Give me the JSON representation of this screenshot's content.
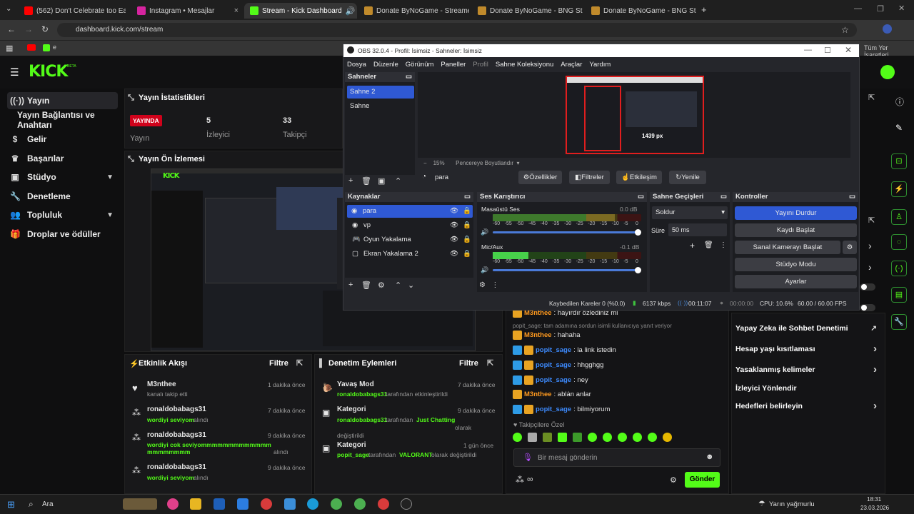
{
  "browser": {
    "tabs": [
      {
        "label": "(562) Don't Celebrate too Early",
        "color": "#ff0000"
      },
      {
        "label": "Instagram • Mesajlar",
        "color": "#d6249f"
      },
      {
        "label": "Stream - Kick Dashboard",
        "color": "#53fc18"
      },
      {
        "label": "Donate ByNoGame - Streamer",
        "color": "#c08a2b"
      },
      {
        "label": "Donate ByNoGame - BNG Strea",
        "color": "#c08a2b"
      },
      {
        "label": "Donate ByNoGame - BNG Stre",
        "color": "#c08a2b"
      }
    ],
    "url": "dashboard.kick.com/stream",
    "bookmark_letter": "e",
    "all_bookmarks": "Tüm Yer İşaretleri"
  },
  "kick": {
    "logo": "KICK",
    "logo_sup": "BETA",
    "nav": [
      {
        "label": "Yayın",
        "icon": "broadcast-icon"
      },
      {
        "label": "Yayın Bağlantısı ve Anahtarı",
        "icon": ""
      },
      {
        "label": "Gelir",
        "icon": "dollar-icon"
      },
      {
        "label": "Başarılar",
        "icon": "trophy-icon"
      },
      {
        "label": "Stüdyo",
        "icon": "camera-icon"
      },
      {
        "label": "Denetleme",
        "icon": "wrench-icon"
      },
      {
        "label": "Topluluk",
        "icon": "users-icon"
      },
      {
        "label": "Droplar ve ödüller",
        "icon": "gift-icon"
      }
    ],
    "stats": {
      "title": "Yayın İstatistikleri",
      "live": "YAYINDA",
      "live_label": "Yayın",
      "viewers": "5",
      "viewers_label": "İzleyici",
      "followers": "33",
      "followers_label": "Takipçi"
    },
    "preview_title": "Yayın Ön İzlemesi",
    "activity": {
      "title": "Etkinlik Akışı",
      "filter": "Filtre",
      "items": [
        {
          "user": "M3nthee",
          "desc": "kanalı takip etti",
          "highlight": "",
          "time": "1 dakika önce"
        },
        {
          "user": "ronaldobabags31",
          "highlight": "wordiyi seviyom",
          "desc": "alındı",
          "time": "7 dakika önce"
        },
        {
          "user": "ronaldobabags31",
          "highlight": "wordiyi cok seviyommmmmmmmmmmmmmmmmmmmm",
          "desc": "alındı",
          "time": "9 dakika önce"
        },
        {
          "user": "ronaldobabags31",
          "highlight": "wordiyi seviyom",
          "desc": "alındı",
          "time": "9 dakika önce"
        }
      ]
    },
    "moderation": {
      "title": "Denetim Eylemleri",
      "filter": "Filtre",
      "items": [
        {
          "title": "Yavaş Mod",
          "who": "ronaldobabags31",
          "mid": "tarafından etkinleştirildi",
          "hl": "",
          "end": "",
          "time": "7 dakika önce"
        },
        {
          "title": "Kategori",
          "who": "ronaldobabags31",
          "mid": "tarafından",
          "hl": "Just Chatting",
          "end": "olarak değiştirildi",
          "time": "9 dakika önce"
        },
        {
          "title": "Kategori",
          "who": "popit_sage",
          "mid": "tarafından",
          "hl": "VALORANT",
          "end": "olarak değiştirildi",
          "time": "1 gün önce"
        }
      ]
    },
    "chat": {
      "messages": [
        {
          "user": "M3nthee",
          "text": ": hayırdır özlediniz mi",
          "color": "#ff9a1f"
        },
        {
          "reply": "popit_sage: tam adamına sordun isimli kullanıcıya yanıt veriyor"
        },
        {
          "user": "M3nthee",
          "text": ": hahaha",
          "color": "#ff9a1f"
        },
        {
          "user": "popit_sage",
          "text": ": la link istedin",
          "color": "#3d8bff"
        },
        {
          "user": "popit_sage",
          "text": ": hhgghgg",
          "color": "#3d8bff"
        },
        {
          "user": "popit_sage",
          "text": ": ney",
          "color": "#3d8bff"
        },
        {
          "user": "M3nthee",
          "text": ": ablȧn anlar",
          "color": "#ff9a1f"
        },
        {
          "user": "popit_sage",
          "text": ": bilmiyorum",
          "color": "#3d8bff"
        }
      ],
      "followers_only": "Takipçilere Özel",
      "placeholder": "Bir mesaj gönderin",
      "send": "Gönder",
      "points": "∞"
    },
    "right_settings": [
      {
        "label": "Yapay Zeka ile Sohbet Denetimi",
        "arrow": "↗"
      },
      {
        "label": "Hesap yaşı kısıtlaması",
        "arrow": "›"
      },
      {
        "label": "Yasaklanmış kelimeler",
        "arrow": "›"
      },
      {
        "label": "İzleyici Yönlendir",
        "arrow": ""
      },
      {
        "label": "Hedefleri belirleyin",
        "arrow": "›"
      }
    ]
  },
  "obs": {
    "title": "OBS 32.0.4 - Profil: İsimsiz - Sahneler: İsimsiz",
    "menu": [
      "Dosya",
      "Düzenle",
      "Görünüm",
      "Paneller",
      "Profil",
      "Sahne Koleksiyonu",
      "Araçlar",
      "Yardım"
    ],
    "scenes": {
      "title": "Sahneler",
      "items": [
        "Sahne 2",
        "Sahne"
      ]
    },
    "zoom": "15%",
    "fit": "Pencereye Boyutlandır",
    "preview_label": "1439 px",
    "source_bar": {
      "name": "para",
      "props": "Özellikler",
      "filters": "Filtreler",
      "interact": "Etkileşim",
      "refresh": "Yenile"
    },
    "sources": {
      "title": "Kaynaklar",
      "items": [
        "para",
        "vp",
        "Oyun Yakalama",
        "Ekran Yakalama 2"
      ]
    },
    "mixer": {
      "title": "Ses Karıştırıcı",
      "channels": [
        {
          "name": "Masaüstü Ses",
          "db": "0.0 dB",
          "level": 0.82
        },
        {
          "name": "Mic/Aux",
          "db": "-0.1 dB",
          "level": 0.24
        }
      ],
      "ticks": [
        "-60",
        "-55",
        "-50",
        "-45",
        "-40",
        "-35",
        "-30",
        "-25",
        "-20",
        "-15",
        "-10",
        "-5",
        "0"
      ]
    },
    "transitions": {
      "title": "Sahne Geçişleri",
      "type": "Soldur",
      "duration_label": "Süre",
      "duration": "50 ms"
    },
    "controls": {
      "title": "Kontroller",
      "buttons": [
        "Yayını Durdur",
        "Kaydı Başlat",
        "Sanal Kamerayı Başlat",
        "Stüdyo Modu",
        "Ayarlar"
      ]
    },
    "status": {
      "dropped": "Kaybedilen Kareler 0 (%0.0)",
      "kbps": "6137 kbps",
      "stream_time": "00:11:07",
      "rec_time": "00:00:00",
      "cpu": "CPU: 10.6%",
      "fps": "60.00 / 60.00 FPS"
    }
  },
  "taskbar": {
    "search": "Ara",
    "weather": "Yarın yağmurlu",
    "time": "18:31",
    "date": "23.03.2026"
  }
}
